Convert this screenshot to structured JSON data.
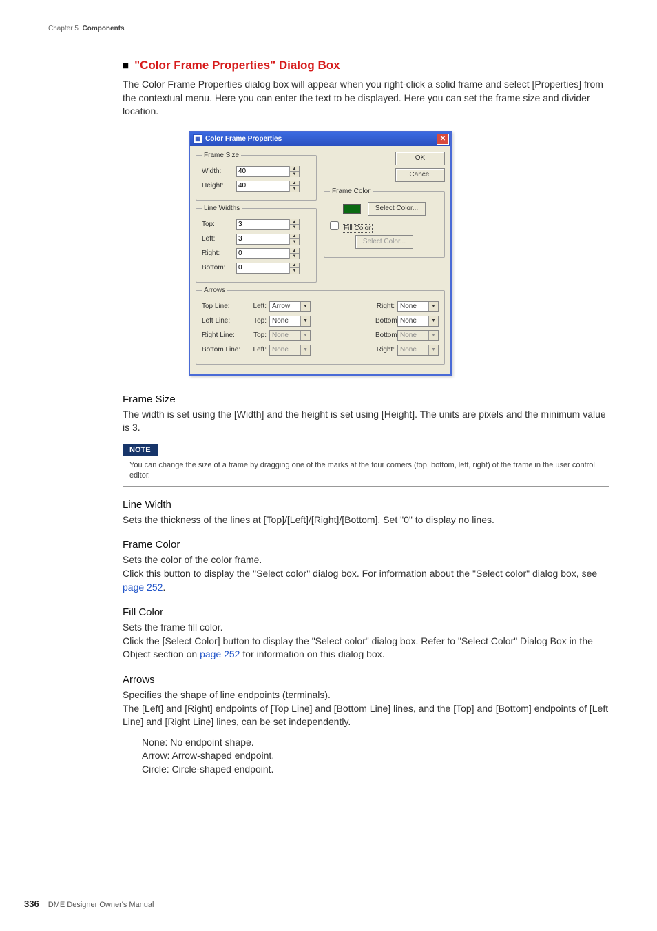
{
  "header": {
    "chapter": "Chapter 5",
    "section": "Components"
  },
  "title": "\"Color Frame Properties\" Dialog Box",
  "intro": "The Color Frame Properties dialog box will appear when you right-click a solid frame and select [Properties] from the contextual menu. Here you can enter the text to be displayed. Here you can set the frame size and divider location.",
  "dialog": {
    "title": "Color Frame Properties",
    "ok": "OK",
    "cancel": "Cancel",
    "frame_size": {
      "legend": "Frame Size",
      "width_label": "Width:",
      "width_value": "40",
      "height_label": "Height:",
      "height_value": "40"
    },
    "line_widths": {
      "legend": "Line Widths",
      "top_label": "Top:",
      "top_value": "3",
      "left_label": "Left:",
      "left_value": "3",
      "right_label": "Right:",
      "right_value": "0",
      "bottom_label": "Bottom:",
      "bottom_value": "0"
    },
    "frame_color": {
      "legend": "Frame Color",
      "swatch": "#0a6a12",
      "select_btn": "Select Color...",
      "fill_chk_label": "Fill Color",
      "fill_select_btn": "Select Color..."
    },
    "arrows": {
      "legend": "Arrows",
      "rows": [
        {
          "name": "Top Line:",
          "l1": "Left:",
          "v1": "Arrow",
          "d1": false,
          "l2": "Right:",
          "v2": "None",
          "d2": false
        },
        {
          "name": "Left Line:",
          "l1": "Top:",
          "v1": "None",
          "d1": false,
          "l2": "Bottom:",
          "v2": "None",
          "d2": false
        },
        {
          "name": "Right Line:",
          "l1": "Top:",
          "v1": "None",
          "d1": true,
          "l2": "Bottom:",
          "v2": "None",
          "d2": true
        },
        {
          "name": "Bottom Line:",
          "l1": "Left:",
          "v1": "None",
          "d1": true,
          "l2": "Right:",
          "v2": "None",
          "d2": true
        }
      ]
    }
  },
  "sections": {
    "frame_size": {
      "h": "Frame Size",
      "p": "The width is set using the [Width] and the height is set using [Height]. The units are pixels and the minimum value is 3."
    },
    "note_label": "NOTE",
    "note_text": "You can change the size of a frame by dragging one of the marks at the four corners (top, bottom, left, right) of the frame in the user control editor.",
    "line_width": {
      "h": "Line Width",
      "p": "Sets the thickness of the lines at [Top]/[Left]/[Right]/[Bottom]. Set \"0\" to display no lines."
    },
    "frame_color": {
      "h": "Frame Color",
      "p1": "Sets the color of the color frame.",
      "p2a": "Click this button to display the \"Select color\" dialog box. For information about the \"Select color\" dialog box, see ",
      "link": "page 252",
      "p2b": "."
    },
    "fill_color": {
      "h": "Fill Color",
      "p1": "Sets the frame fill color.",
      "p2a": "Click the [Select Color] button to display the \"Select color\" dialog box. Refer to \"Select Color\" Dialog Box in the Object section on ",
      "link": "page 252",
      "p2b": " for information on this dialog box."
    },
    "arrows": {
      "h": "Arrows",
      "p1": "Specifies the shape of line endpoints (terminals).",
      "p2": "The [Left] and [Right] endpoints of [Top Line] and [Bottom Line] lines, and the [Top] and [Bottom] endpoints of [Left Line] and [Right Line] lines, can be set independently.",
      "list": {
        "a": "None: No endpoint shape.",
        "b": "Arrow: Arrow-shaped endpoint.",
        "c": "Circle: Circle-shaped endpoint."
      }
    }
  },
  "footer": {
    "page": "336",
    "text": "DME Designer Owner's Manual"
  }
}
